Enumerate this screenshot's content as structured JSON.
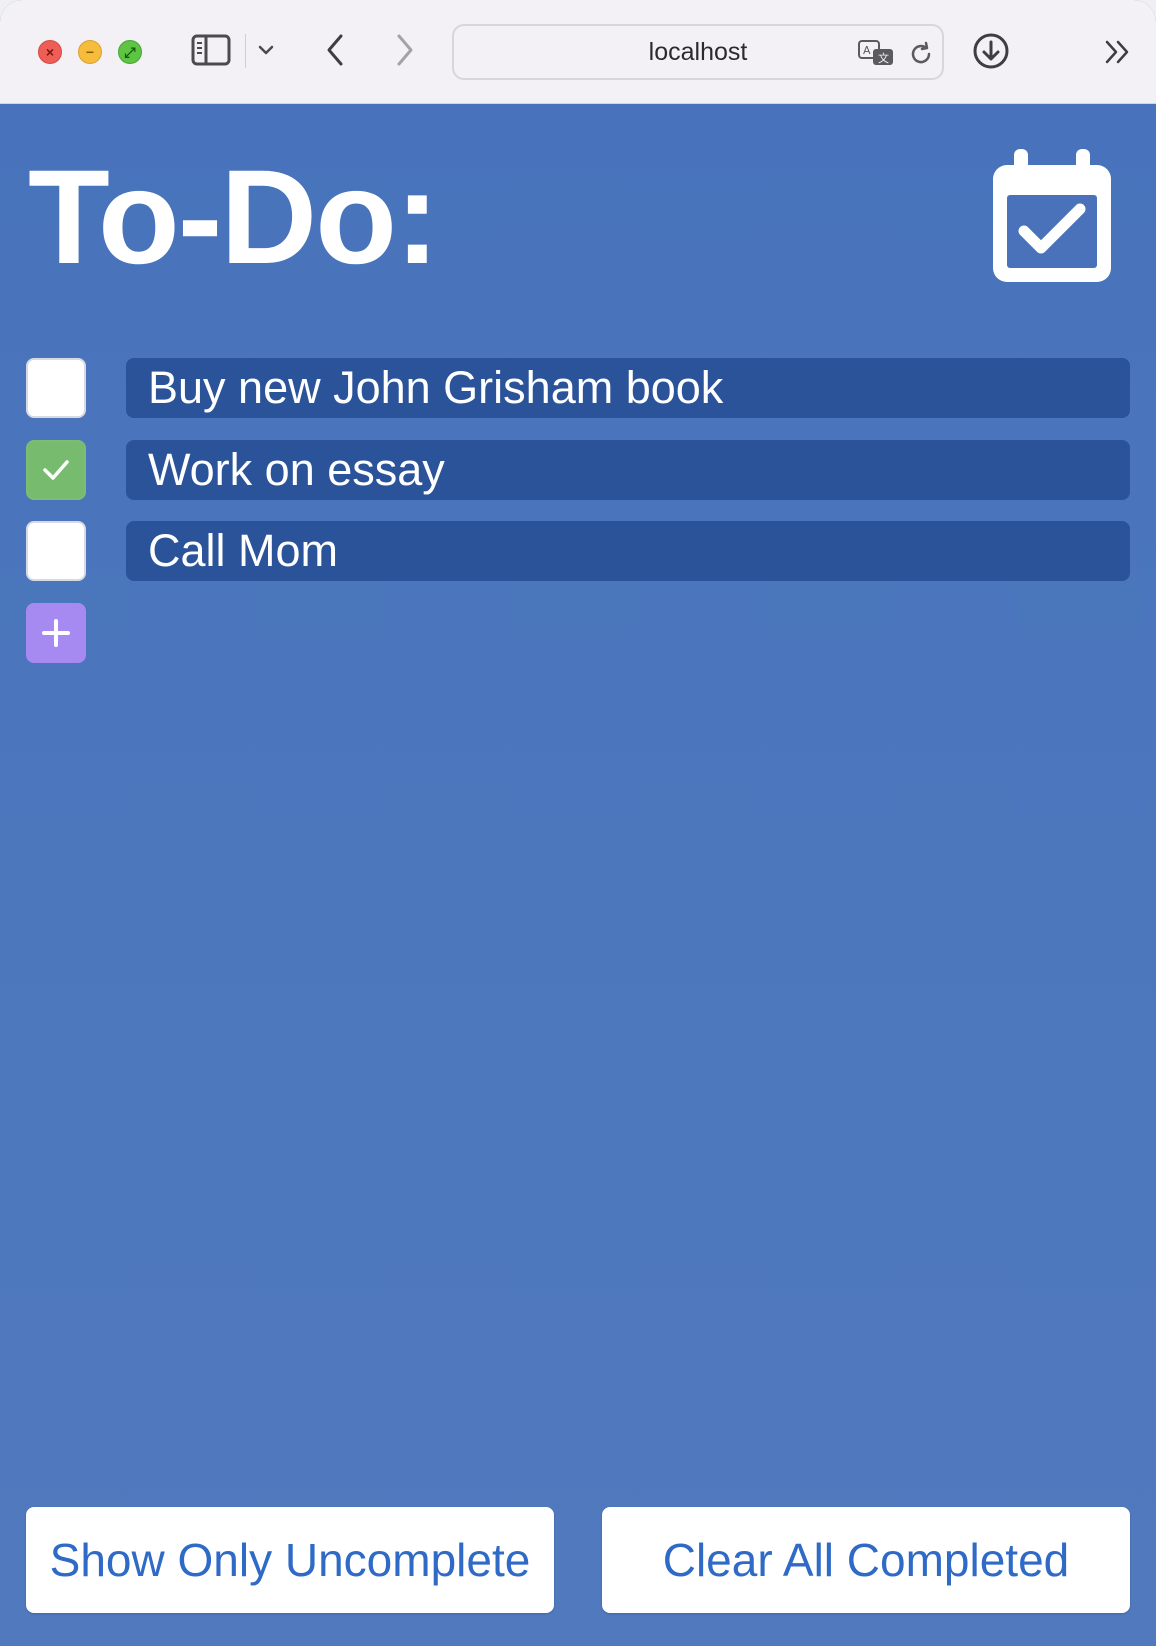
{
  "browser": {
    "url": "localhost",
    "window_controls": {
      "close_icon": "close-icon",
      "minimize_icon": "minimize-icon",
      "zoom_icon": "fullscreen-icon"
    },
    "toolbar_icons": [
      "sidebar-icon",
      "chevron-down-icon",
      "back-arrow-icon",
      "forward-arrow-icon",
      "translate-icon",
      "reload-icon",
      "download-icon",
      "more-chevrons-icon"
    ]
  },
  "app": {
    "title": "To-Do:",
    "header_icon": "calendar-check-icon",
    "todos": [
      {
        "text": "Buy new John Grisham book",
        "completed": false
      },
      {
        "text": "Work on essay",
        "completed": true
      },
      {
        "text": "Call Mom",
        "completed": false
      }
    ],
    "add_icon": "plus-icon",
    "buttons": {
      "show_uncomplete": "Show Only Uncomplete",
      "clear_completed": "Clear All Completed"
    }
  },
  "colors": {
    "background": "#4a72bb",
    "todo_field": "#2b5399",
    "checked": "#76bb6e",
    "add_button": "#a68af1",
    "button_text": "#2f6ac7"
  }
}
